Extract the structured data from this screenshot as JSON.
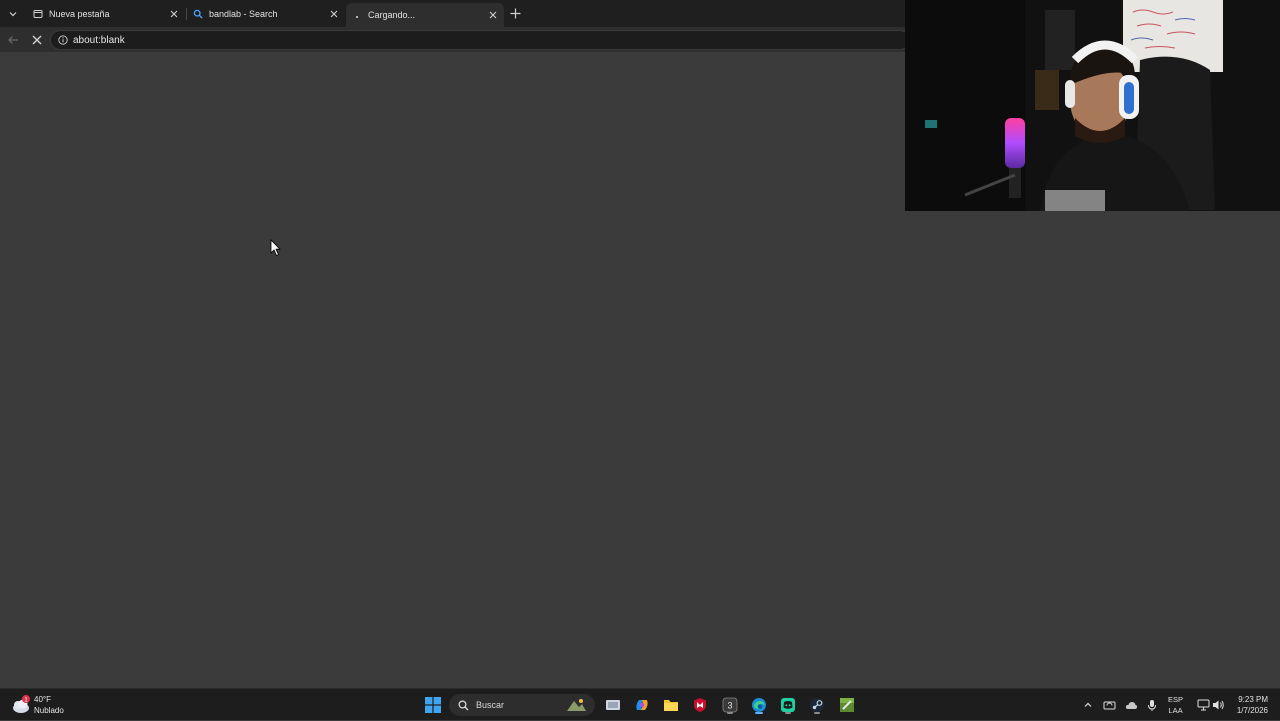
{
  "tabs": [
    {
      "title": "Nueva pestaña",
      "favicon": "newtab-icon"
    },
    {
      "title": "bandlab - Search",
      "favicon": "search-icon"
    },
    {
      "title": "Cargando...",
      "favicon": "loading-icon",
      "active": true
    }
  ],
  "address_bar": {
    "url": "about:blank"
  },
  "taskbar": {
    "weather": {
      "temperature": "40°F",
      "condition": "Nublado",
      "alert_badge": "1"
    },
    "search": {
      "placeholder": "Buscar"
    },
    "pinned_apps": [
      "windows-start-icon",
      "task-view-icon",
      "copilot-icon",
      "file-explorer-icon",
      "mcafee-icon",
      "app-3-icon",
      "edge-icon",
      "discord-icon",
      "steam-icon",
      "minecraft-icon"
    ],
    "language": {
      "line1": "ESP",
      "line2": "LAA"
    },
    "clock": {
      "time": "9:23 PM",
      "date": "1/7/2026"
    }
  },
  "colors": {
    "page_bg": "#3b3b3b",
    "tabstrip_bg": "#1f1f1f",
    "accent": "#0078d4"
  }
}
